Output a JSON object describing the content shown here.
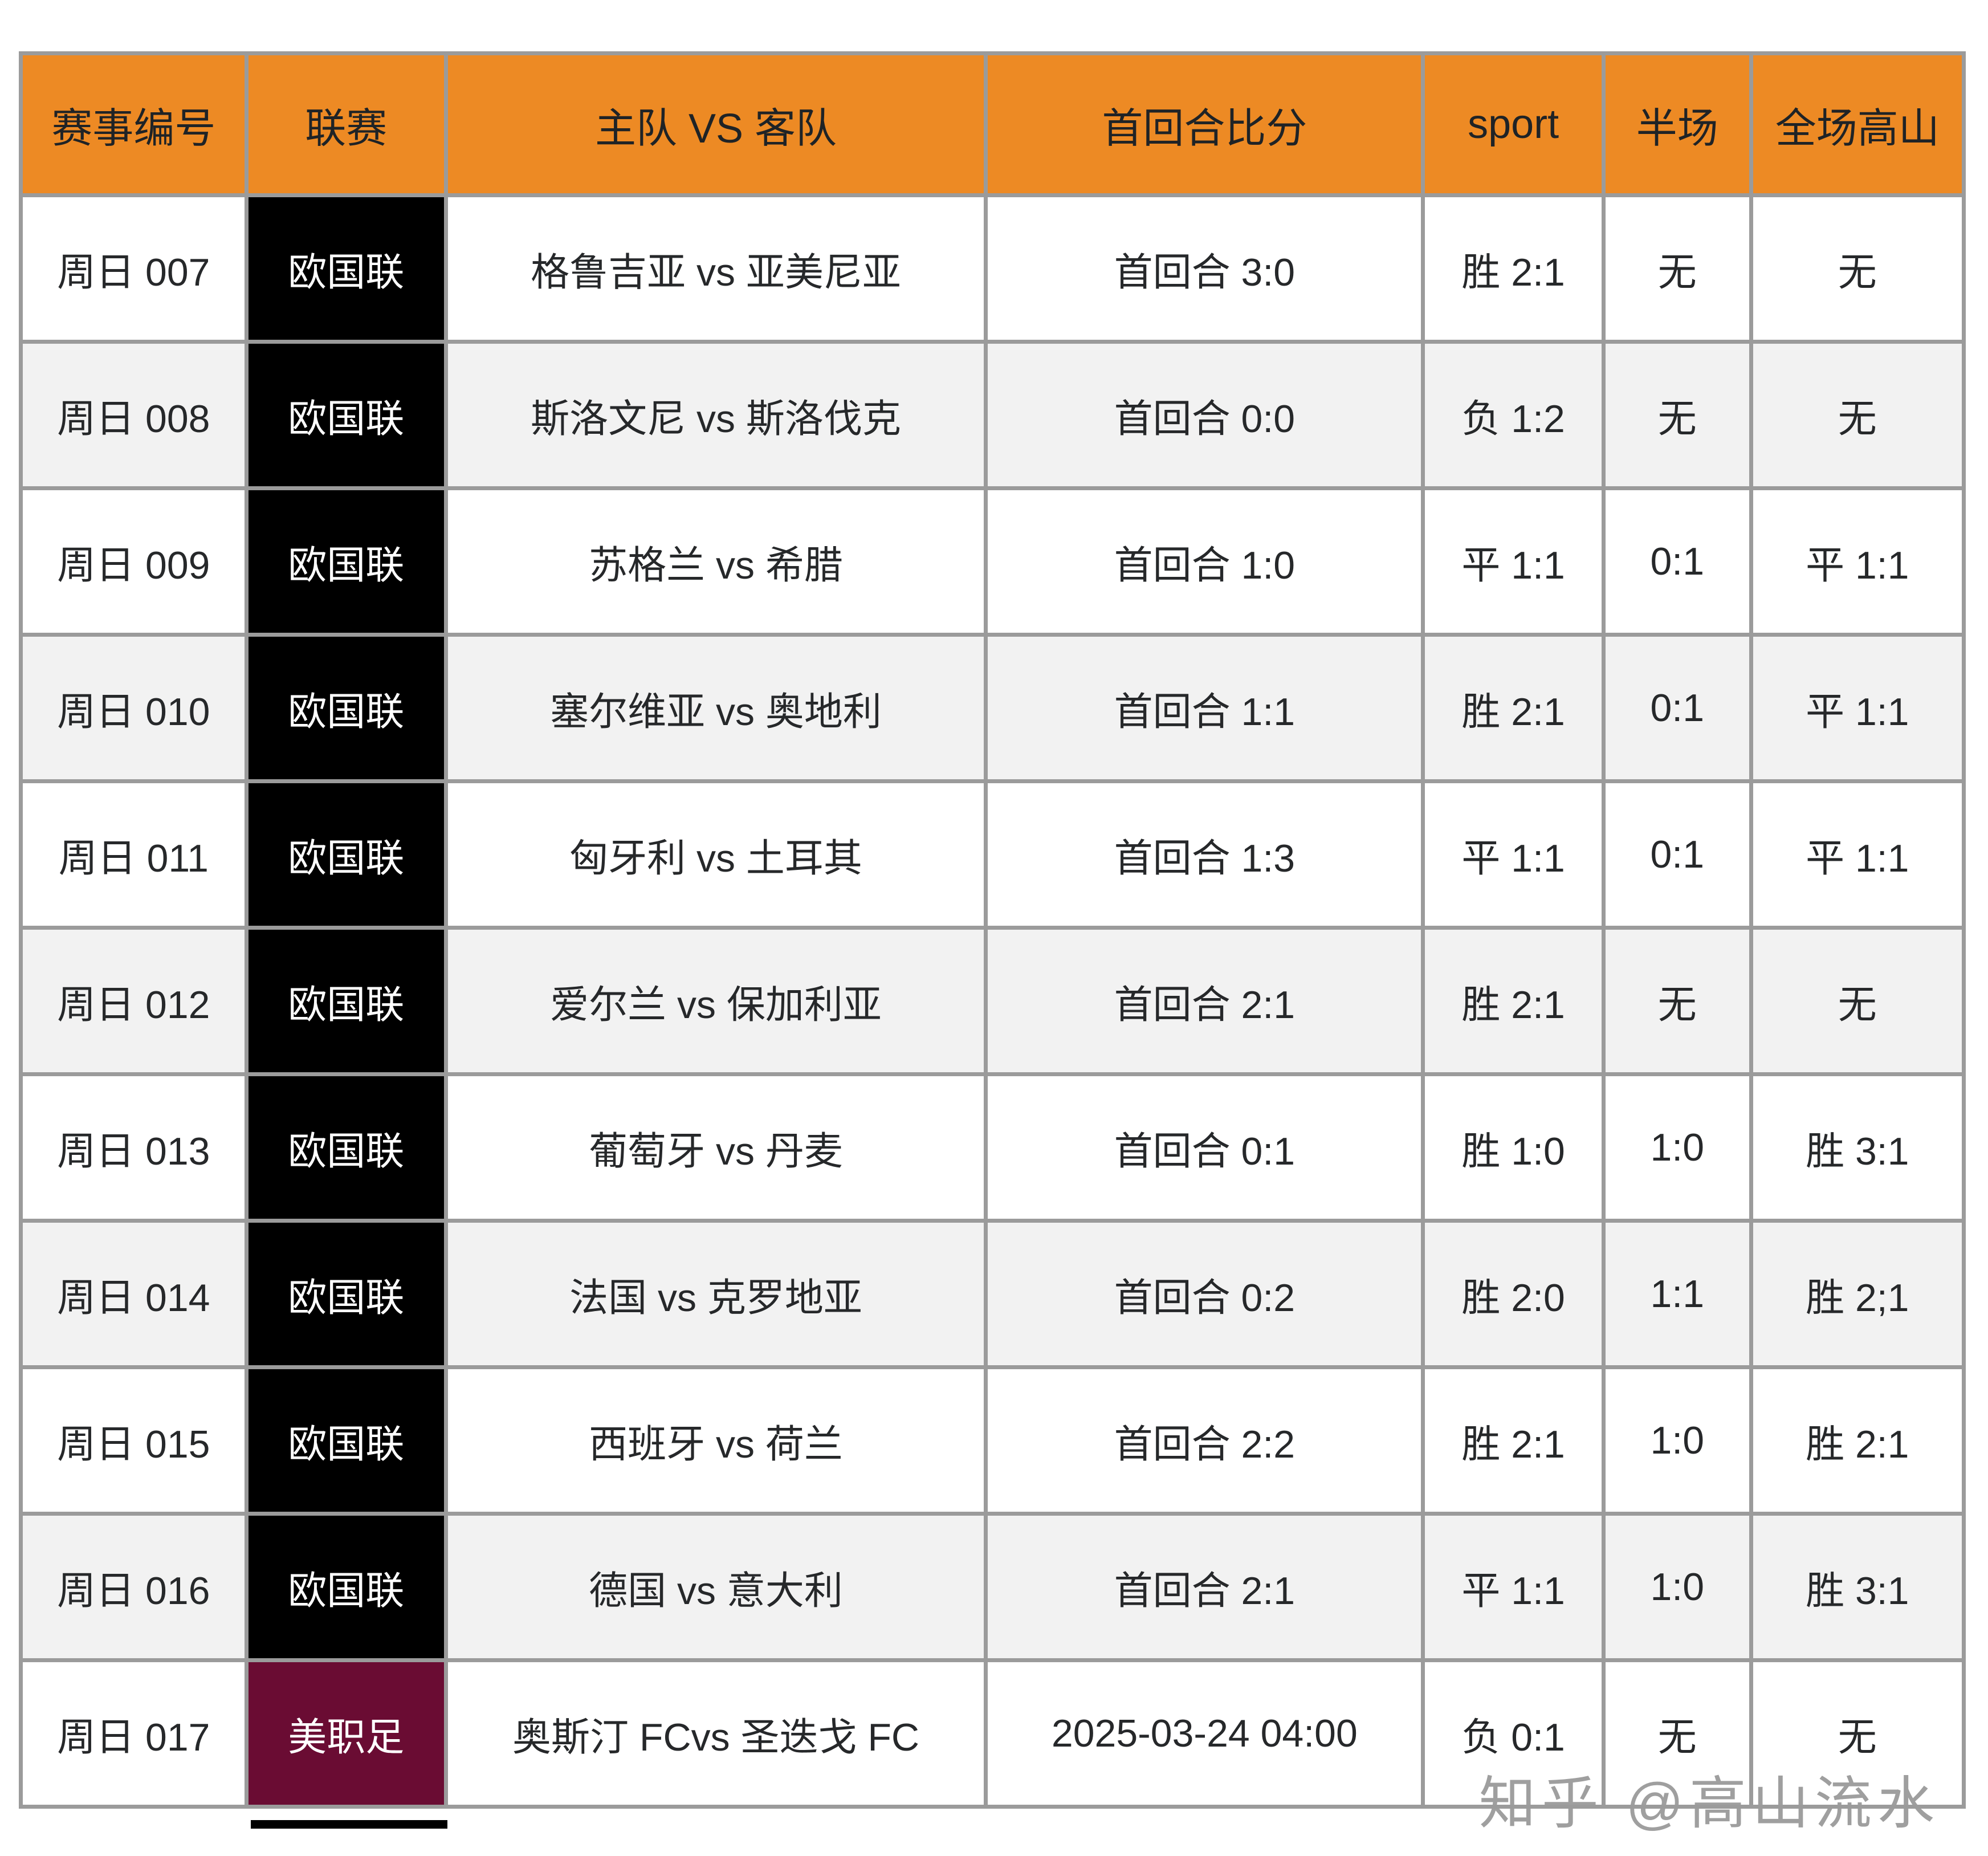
{
  "chart_data": {
    "type": "table",
    "title": "",
    "columns": [
      "赛事编号",
      "联赛",
      "主队 VS 客队",
      "首回合比分",
      "sport",
      "半场",
      "全场高山"
    ],
    "rows": [
      {
        "id": "周日 007",
        "league": "欧国联",
        "teams": "格鲁吉亚 vs 亚美尼亚",
        "first_leg": "首回合 3:0",
        "sport": "胜 2:1",
        "half": "无",
        "full": "无",
        "league_bg": "#000000"
      },
      {
        "id": "周日 008",
        "league": "欧国联",
        "teams": "斯洛文尼 vs 斯洛伐克",
        "first_leg": "首回合 0:0",
        "sport": "负 1:2",
        "half": "无",
        "full": "无",
        "league_bg": "#000000"
      },
      {
        "id": "周日 009",
        "league": "欧国联",
        "teams": "苏格兰 vs 希腊",
        "first_leg": "首回合 1:0",
        "sport": "平 1:1",
        "half": "0:1",
        "full": "平 1:1",
        "league_bg": "#000000"
      },
      {
        "id": "周日 010",
        "league": "欧国联",
        "teams": "塞尔维亚 vs 奥地利",
        "first_leg": "首回合 1:1",
        "sport": "胜 2:1",
        "half": "0:1",
        "full": "平 1:1",
        "league_bg": "#000000"
      },
      {
        "id": "周日 011",
        "league": "欧国联",
        "teams": "匈牙利 vs 土耳其",
        "first_leg": "首回合 1:3",
        "sport": "平 1:1",
        "half": "0:1",
        "full": "平 1:1",
        "league_bg": "#000000"
      },
      {
        "id": "周日 012",
        "league": "欧国联",
        "teams": "爱尔兰 vs 保加利亚",
        "first_leg": "首回合 2:1",
        "sport": "胜 2:1",
        "half": "无",
        "full": "无",
        "league_bg": "#000000"
      },
      {
        "id": "周日 013",
        "league": "欧国联",
        "teams": "葡萄牙 vs 丹麦",
        "first_leg": "首回合 0:1",
        "sport": "胜 1:0",
        "half": "1:0",
        "full": "胜 3:1",
        "league_bg": "#000000"
      },
      {
        "id": "周日 014",
        "league": "欧国联",
        "teams": "法国 vs 克罗地亚",
        "first_leg": "首回合 0:2",
        "sport": "胜 2:0",
        "half": "1:1",
        "full": "胜 2;1",
        "league_bg": "#000000"
      },
      {
        "id": "周日 015",
        "league": "欧国联",
        "teams": "西班牙 vs 荷兰",
        "first_leg": "首回合 2:2",
        "sport": "胜 2:1",
        "half": "1:0",
        "full": "胜 2:1",
        "league_bg": "#000000"
      },
      {
        "id": "周日 016",
        "league": "欧国联",
        "teams": "德国 vs 意大利",
        "first_leg": "首回合 2:1",
        "sport": "平 1:1",
        "half": "1:0",
        "full": "胜 3:1",
        "league_bg": "#000000"
      },
      {
        "id": "周日 017",
        "league": "美职足",
        "teams": "奥斯汀 FCvs 圣迭戈 FC",
        "first_leg": "2025-03-24 04:00",
        "sport": "负 0:1",
        "half": "无",
        "full": "无",
        "league_bg": "#6a0c33"
      }
    ],
    "layout": {
      "grid": true,
      "zebra_striping": true,
      "header_position": "top"
    }
  },
  "watermark": "知乎 @高山流水",
  "colors": {
    "header_bg": "#ed8a24",
    "league_default_bg": "#000000",
    "league_mls_bg": "#6a0c33",
    "border": "#9b9b9b",
    "row_alt_bg": "#f2f2f2",
    "text": "#26282a",
    "league_text": "#ffffff",
    "watermark": "#9f9f9f"
  }
}
